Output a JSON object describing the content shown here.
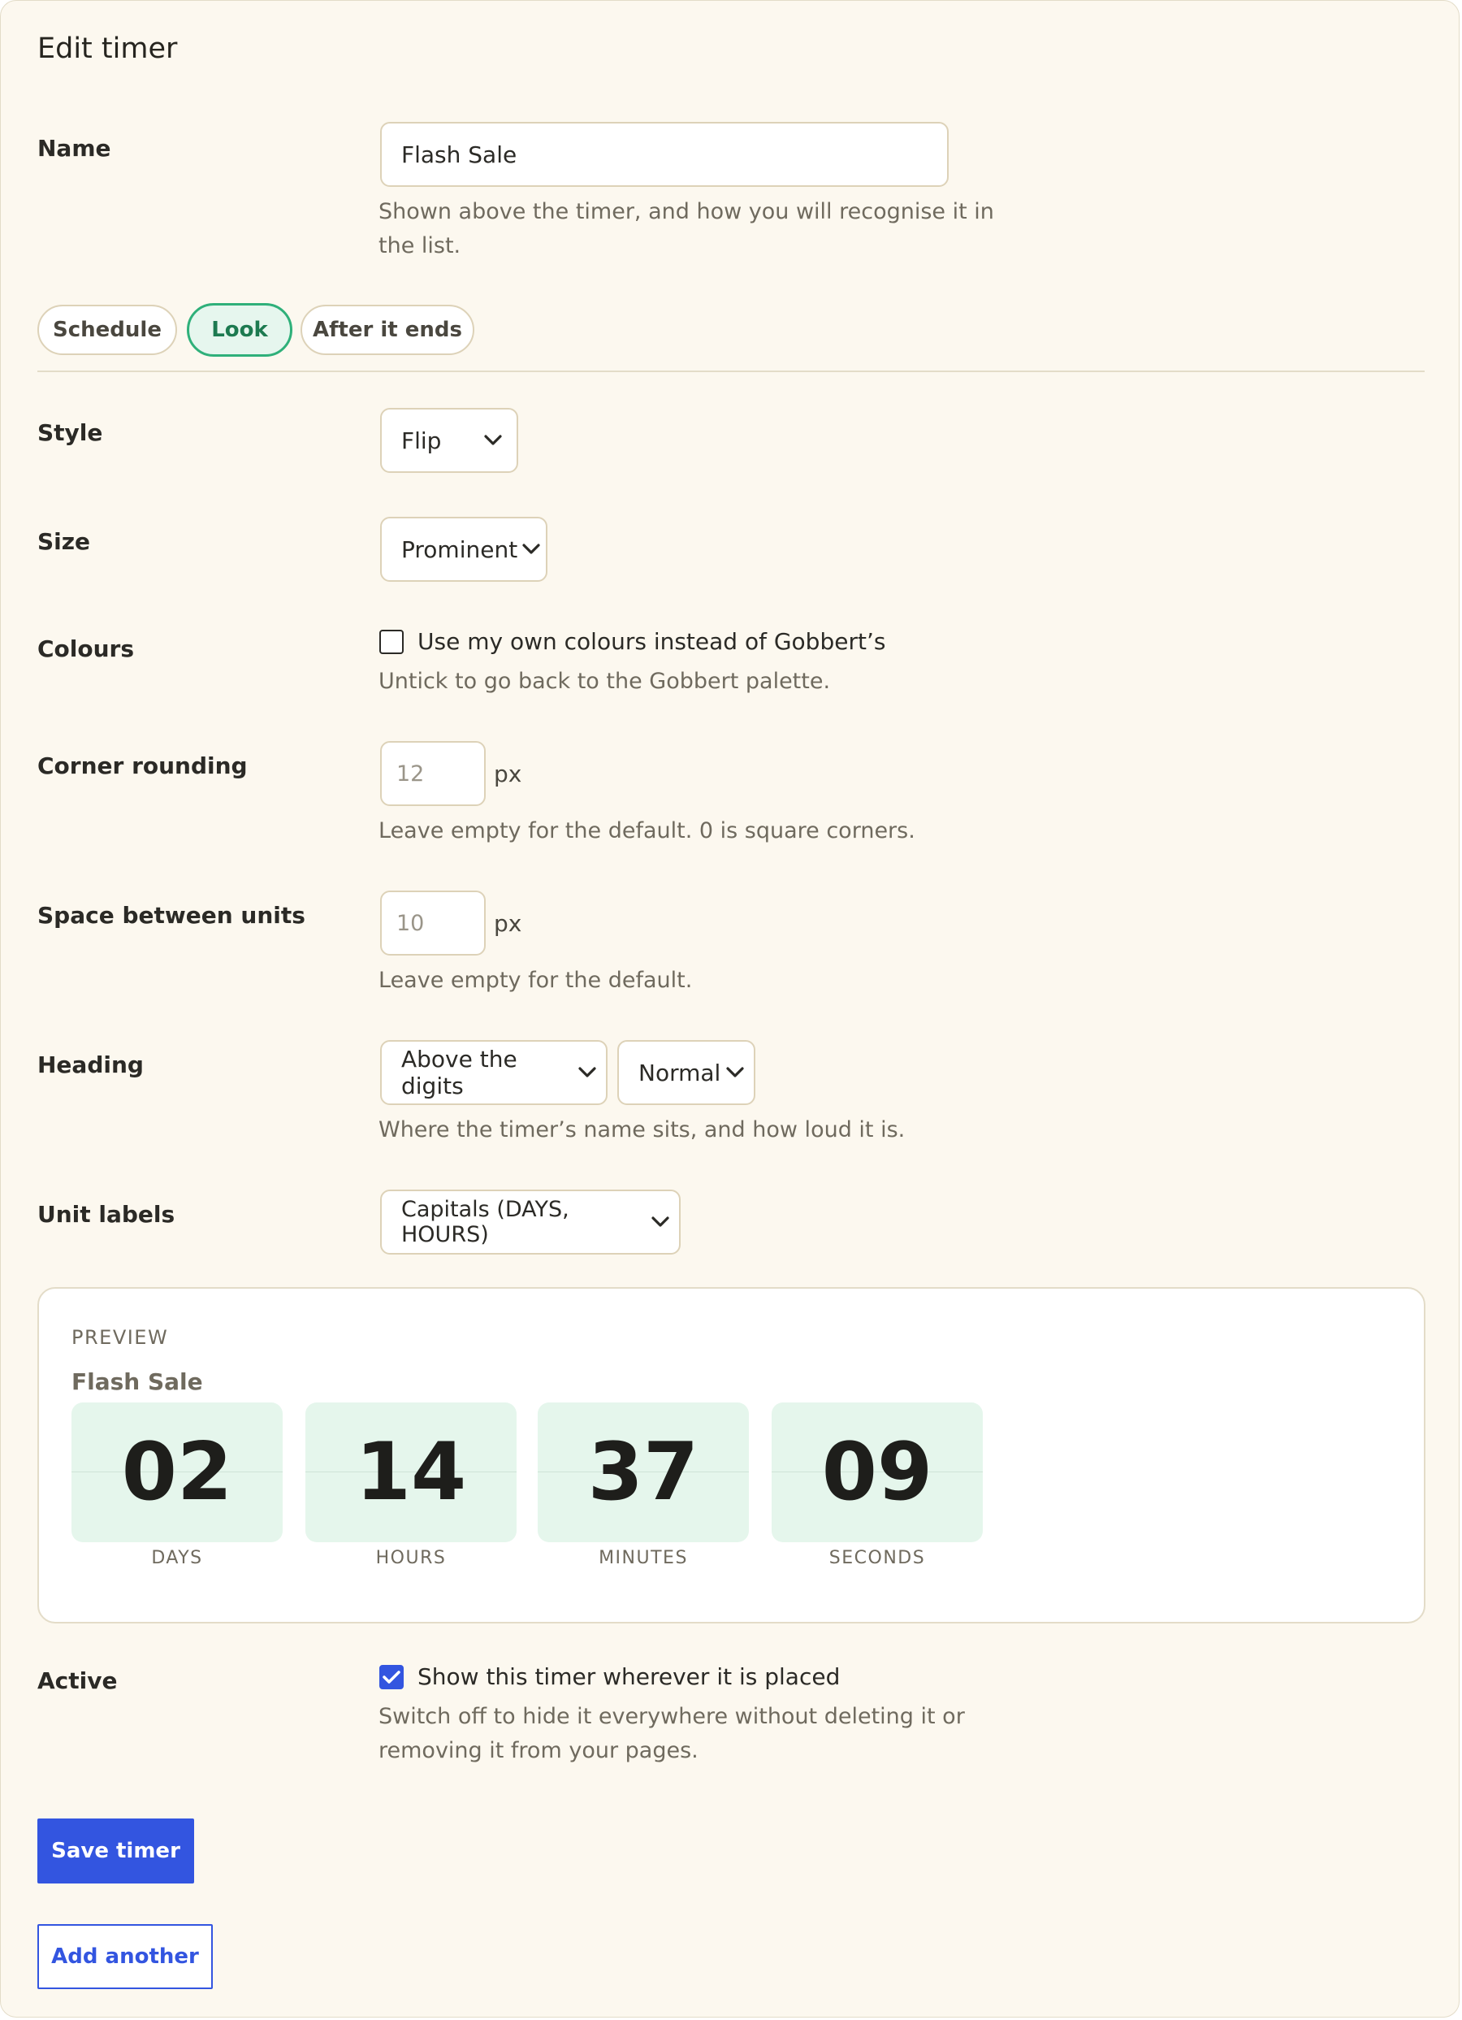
{
  "header": {
    "title": "Edit timer"
  },
  "name": {
    "label": "Name",
    "value": "Flash Sale",
    "help": "Shown above the timer, and how you will recognise it in the list."
  },
  "tabs": [
    {
      "label": "Schedule",
      "active": false
    },
    {
      "label": "Look",
      "active": true
    },
    {
      "label": "After it ends",
      "active": false
    }
  ],
  "style": {
    "label": "Style",
    "value": "Flip"
  },
  "size": {
    "label": "Size",
    "value": "Prominent"
  },
  "colours": {
    "label": "Colours",
    "checkbox_label": "Use my own colours instead of Gobbert’s",
    "checked": false,
    "help": "Untick to go back to the Gobbert palette."
  },
  "corner_rounding": {
    "label": "Corner rounding",
    "placeholder": "12",
    "unit": "px",
    "help": "Leave empty for the default. 0 is square corners."
  },
  "space_between": {
    "label": "Space between units",
    "placeholder": "10",
    "unit": "px",
    "help": "Leave empty for the default."
  },
  "heading": {
    "label": "Heading",
    "position_value": "Above the digits",
    "size_value": "Normal",
    "help": "Where the timer’s name sits, and how loud it is."
  },
  "unit_labels": {
    "label": "Unit labels",
    "value": "Capitals (DAYS, HOURS)"
  },
  "preview": {
    "caption": "PREVIEW",
    "name": "Flash Sale",
    "units": [
      {
        "value": "02",
        "label": "DAYS"
      },
      {
        "value": "14",
        "label": "HOURS"
      },
      {
        "value": "37",
        "label": "MINUTES"
      },
      {
        "value": "09",
        "label": "SECONDS"
      }
    ]
  },
  "active": {
    "label": "Active",
    "checkbox_label": "Show this timer wherever it is placed",
    "checked": true,
    "help": "Switch off to hide it everywhere without deleting it or removing it from your pages."
  },
  "actions": {
    "save_label": "Save timer",
    "add_label": "Add another"
  },
  "colors": {
    "accent": "#3355e0",
    "tab_active": "#2fb07a",
    "preview_digit_bg": "#e5f6ec",
    "background": "#fcf8ef"
  }
}
